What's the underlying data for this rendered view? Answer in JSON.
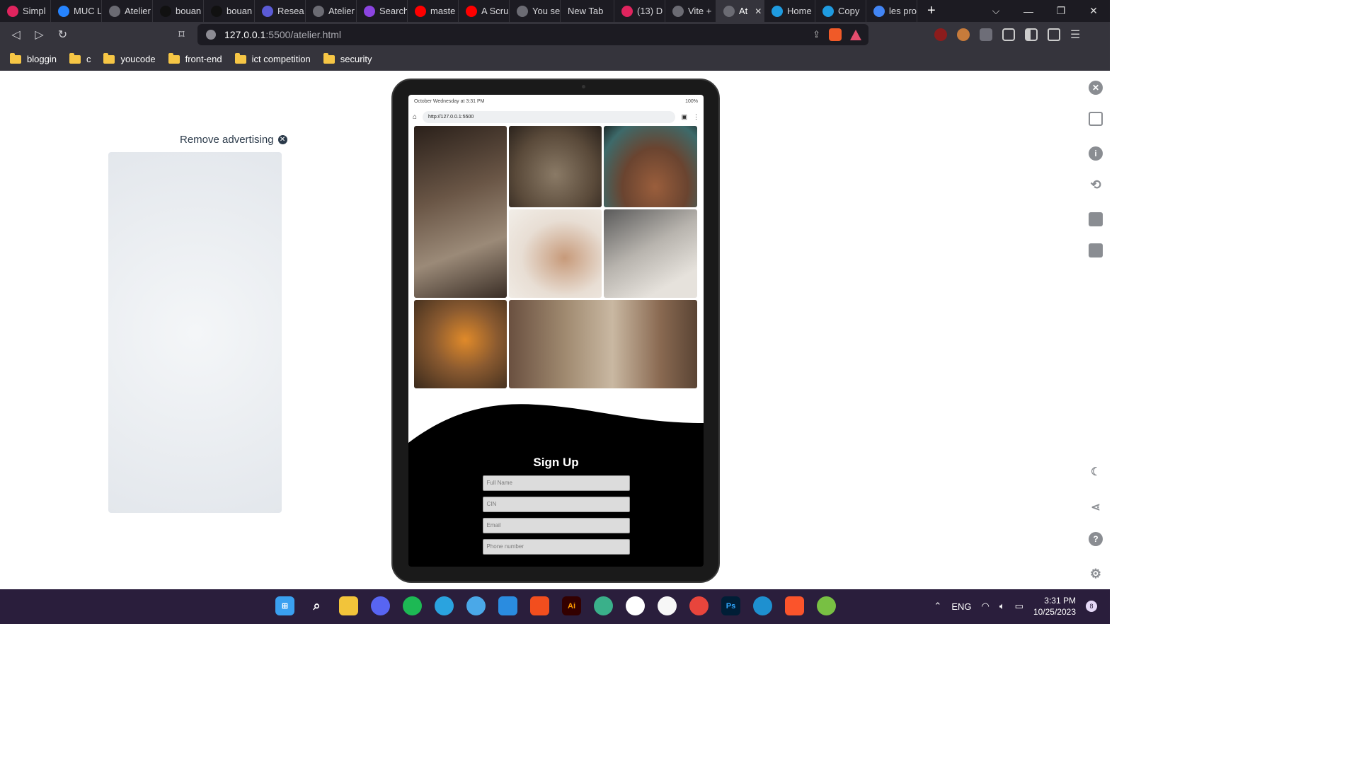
{
  "tabs": [
    {
      "label": "Simpl",
      "color": "#e0245e"
    },
    {
      "label": "MUC L",
      "color": "#2684ff"
    },
    {
      "label": "Atelier",
      "color": "#6b6b73"
    },
    {
      "label": "bouan",
      "color": "#111111"
    },
    {
      "label": "bouan",
      "color": "#111111"
    },
    {
      "label": "Resea",
      "color": "#5b5bd6"
    },
    {
      "label": "Atelier",
      "color": "#6b6b73"
    },
    {
      "label": "Search",
      "color": "#8b44e0"
    },
    {
      "label": "maste",
      "color": "#ff0000"
    },
    {
      "label": "A Scru",
      "color": "#ff0000"
    },
    {
      "label": "You se",
      "color": "#6b6b73"
    },
    {
      "label": "New Tab",
      "color": ""
    },
    {
      "label": "(13) D",
      "color": "#e0245e"
    },
    {
      "label": "Vite +",
      "color": "#6b6b73"
    },
    {
      "label": "At",
      "color": "#6b6b73",
      "active": true
    },
    {
      "label": "Home",
      "color": "#1f9be0"
    },
    {
      "label": "Copy",
      "color": "#1f9be0"
    },
    {
      "label": "les pro",
      "color": "#4285f4"
    }
  ],
  "address": {
    "host": "127.0.0.1",
    "path": ":5500/atelier.html"
  },
  "bookmarks": [
    "bloggin",
    "c",
    "youcode",
    "front-end",
    "ict competition",
    "security"
  ],
  "ad": {
    "remove_label": "Remove advertising"
  },
  "device": {
    "status_left": "October Wednesday at 3:31 PM",
    "status_right": "100%",
    "url": "http://127.0.0.1:5500"
  },
  "signup": {
    "title": "Sign Up",
    "fields": [
      "Full Name",
      "CIN",
      "Email",
      "Phone number"
    ]
  },
  "taskbar": {
    "lang": "ENG",
    "time": "3:31 PM",
    "date": "10/25/2023",
    "notifications": "8"
  }
}
